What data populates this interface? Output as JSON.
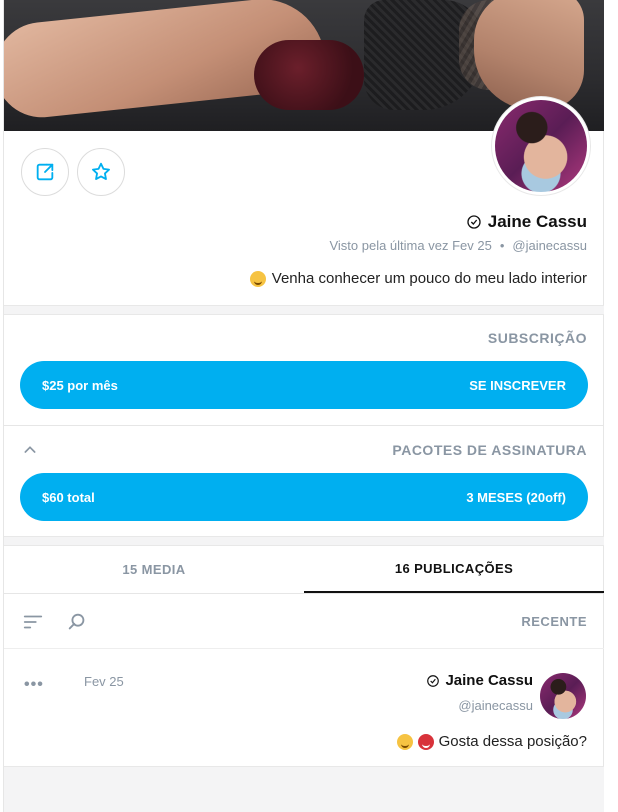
{
  "profile": {
    "name": "Jaine Cassu",
    "handle": "@jainecassu",
    "separator": "•",
    "last_seen": "Visto pela última vez Fev 25",
    "bio": "Venha conhecer um pouco do meu lado interior",
    "bio_emoji": "smiling-face"
  },
  "actions": {
    "share_icon": "share-icon",
    "favorite_icon": "star-icon"
  },
  "subscription": {
    "title": "SUBSCRIÇÃO",
    "button_label": "SE INSCREVER",
    "button_price": "$25 por mês"
  },
  "bundles": {
    "title": "PACOTES DE ASSINATURA",
    "button_label": "3 MESES (20off)",
    "button_price": "$60 total"
  },
  "tabs": [
    {
      "label": "16 PUBLICAÇÕES",
      "active": true
    },
    {
      "label": "15 MEDIA",
      "active": false
    }
  ],
  "feed": {
    "sort_label": "RECENTE"
  },
  "post": {
    "author": "Jaine Cassu",
    "handle": "@jainecassu",
    "date": "Fev 25",
    "more": "•••",
    "text": "Gosta dessa posição?"
  },
  "colors": {
    "accent": "#00aff0",
    "muted": "#8a96a3"
  }
}
